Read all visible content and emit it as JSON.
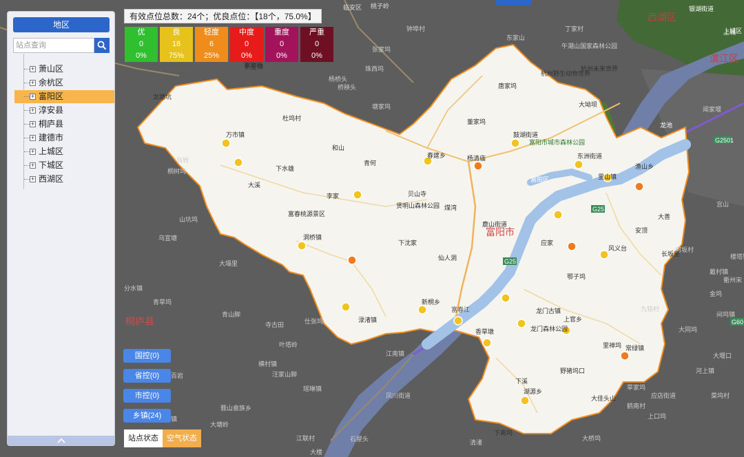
{
  "sidebar": {
    "title": "地区",
    "search_placeholder": "站点查询",
    "tree_items": [
      {
        "label": "萧山区",
        "selected": false
      },
      {
        "label": "余杭区",
        "selected": false
      },
      {
        "label": "富阳区",
        "selected": true
      },
      {
        "label": "淳安县",
        "selected": false
      },
      {
        "label": "桐庐县",
        "selected": false
      },
      {
        "label": "建德市",
        "selected": false
      },
      {
        "label": "上城区",
        "selected": false
      },
      {
        "label": "下城区",
        "selected": false
      },
      {
        "label": "西湖区",
        "selected": false
      }
    ]
  },
  "summary_text": "有效点位总数：24个；优良点位：【18个，75.0%】",
  "legend": [
    {
      "label": "优",
      "count": "0",
      "pct": "0%",
      "color": "#2fbf2f"
    },
    {
      "label": "良",
      "count": "18",
      "pct": "75%",
      "color": "#e7c21a"
    },
    {
      "label": "轻度",
      "count": "6",
      "pct": "25%",
      "color": "#f08c1c"
    },
    {
      "label": "中度",
      "count": "0",
      "pct": "0%",
      "color": "#e81b1b"
    },
    {
      "label": "重度",
      "count": "0",
      "pct": "0%",
      "color": "#a3135c"
    },
    {
      "label": "严重",
      "count": "0",
      "pct": "0%",
      "color": "#6e0f24"
    }
  ],
  "controls": {
    "national": "国控(0)",
    "provincial": "省控(0)",
    "municipal": "市控(0)",
    "township": "乡镇(24)"
  },
  "tabs": {
    "station_status": "站点状态",
    "air_status": "空气状态"
  },
  "map": {
    "labels": [
      "临安区",
      "桃子岭",
      "银湖街道",
      "上城区",
      "西湖区",
      "滨江区",
      "富阳区",
      "富阳市",
      "桐庐县",
      "富春桃源景区",
      "贤明山森林公园",
      "富阳市城市森林公园",
      "龙门古镇",
      "龙门森林公园",
      "杭州野生动物世界",
      "杭州未来世界",
      "大坳坝",
      "龙池",
      "东洲街道",
      "渔山乡",
      "里山镇",
      "大善",
      "安顶",
      "风义台",
      "长坂里",
      "万市镇",
      "杜坞村",
      "和山",
      "下水雄",
      "大溪",
      "李家",
      "青何",
      "贝山寺",
      "煤湾",
      "仙人洞",
      "下沈家",
      "洞桥镇",
      "渌渚镇",
      "新桐乡",
      "鹿山街道",
      "应家",
      "鄂子坞",
      "上官乡",
      "常绿镇",
      "湖源乡",
      "下溪",
      "香草墩",
      "里禅坞",
      "野猪坞口",
      "大佳头山",
      "春建乡",
      "杨清庙",
      "鼓湖街道",
      "唐家坞",
      "董家坞",
      "龙塘坑",
      "新登镇",
      "李家坞",
      "富春江",
      "间坞镇",
      "山坑坞",
      "乌宣塘",
      "大塌里",
      "分水镇",
      "青草坞",
      "青山脚",
      "寺古田",
      "仕张坞",
      "江南镇",
      "凤川街道",
      "横村镇",
      "汪家山脚",
      "瑶琳镇",
      "莪山畲族乡",
      "百江镇",
      "九铭村",
      "草家坞",
      "石屋头",
      "下南坞",
      "应店街道",
      "何坂村",
      "上口坞",
      "金坞",
      "大同坞",
      "江联村",
      "大堰口",
      "大塘岭",
      "张家坞",
      "杨桥头",
      "珠西坞",
      "桥秧头",
      "钟埠村",
      "东家山",
      "午潮山国家森林公园",
      "丁家村",
      "桐树坞",
      "马铃",
      "塘家坞",
      "上城",
      "闻家堰",
      "宫山",
      "戴村镇",
      "河上镇",
      "楼塔镇",
      "大桥坞",
      "百岩",
      "叶塔岭",
      "清渚",
      "鹤南村",
      "菜坞村",
      "衢州宋",
      "大楼",
      "桐庐街道"
    ],
    "highway_labels": [
      "G25",
      "G25",
      "G2501",
      "G60"
    ]
  }
}
